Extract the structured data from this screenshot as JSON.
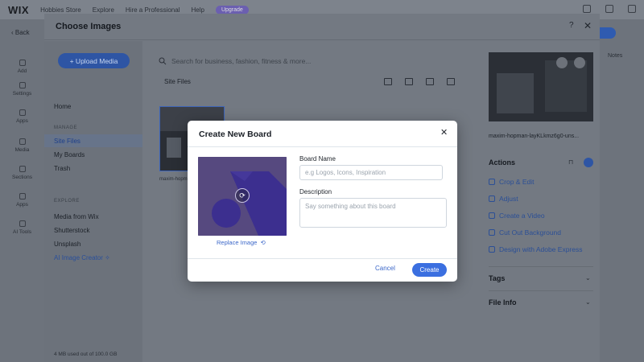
{
  "editor": {
    "logo": "WIX",
    "topbar_items": [
      "Hobbies Store",
      "Explore",
      "Hire a Professional",
      "Help"
    ],
    "upgrade_label": "Upgrade",
    "back_label": "Back",
    "tools": [
      "Add",
      "Settings",
      "Apps",
      "Media",
      "Sections",
      "Apps",
      "AI Tools"
    ],
    "notes_label": "Notes"
  },
  "panel": {
    "title": "Choose Images",
    "help": "?",
    "close": "✕",
    "upload_label": "+ Upload Media",
    "home_label": "Home",
    "manage_heading": "MANAGE",
    "manage_items": [
      "Site Files",
      "My Boards",
      "Trash"
    ],
    "explore_heading": "EXPLORE",
    "explore_items": [
      "Media from Wix",
      "Shutterstock",
      "Unsplash"
    ],
    "ai_creator_label": "AI Image Creator",
    "storage_note": "4 MB used out of 100.0 GB",
    "search_placeholder": "Search for business, fashion, fitness & more...",
    "breadcrumb": "Site Files",
    "thumb_name": "maxim-hopm..."
  },
  "info": {
    "file_name": "maxim-hopman-layKLkmz6g0-uns...",
    "actions_title": "Actions",
    "actions": [
      "Crop & Edit",
      "Adjust",
      "Create a Video",
      "Cut Out Background",
      "Design with Adobe Express"
    ],
    "tags_title": "Tags",
    "file_info_title": "File Info"
  },
  "dialog": {
    "title": "Create New Board",
    "close": "✕",
    "replace_label": "Replace Image",
    "name_label": "Board Name",
    "name_placeholder": "e.g Logos, Icons, Inspiration",
    "name_value": "",
    "description_label": "Description",
    "description_placeholder": "Say something about this board",
    "cancel_label": "Cancel",
    "create_label": "Create"
  },
  "colors": {
    "accent": "#3b6fe0",
    "board_image_bg": "#56497f",
    "board_image_shape": "#3c2f8f"
  }
}
